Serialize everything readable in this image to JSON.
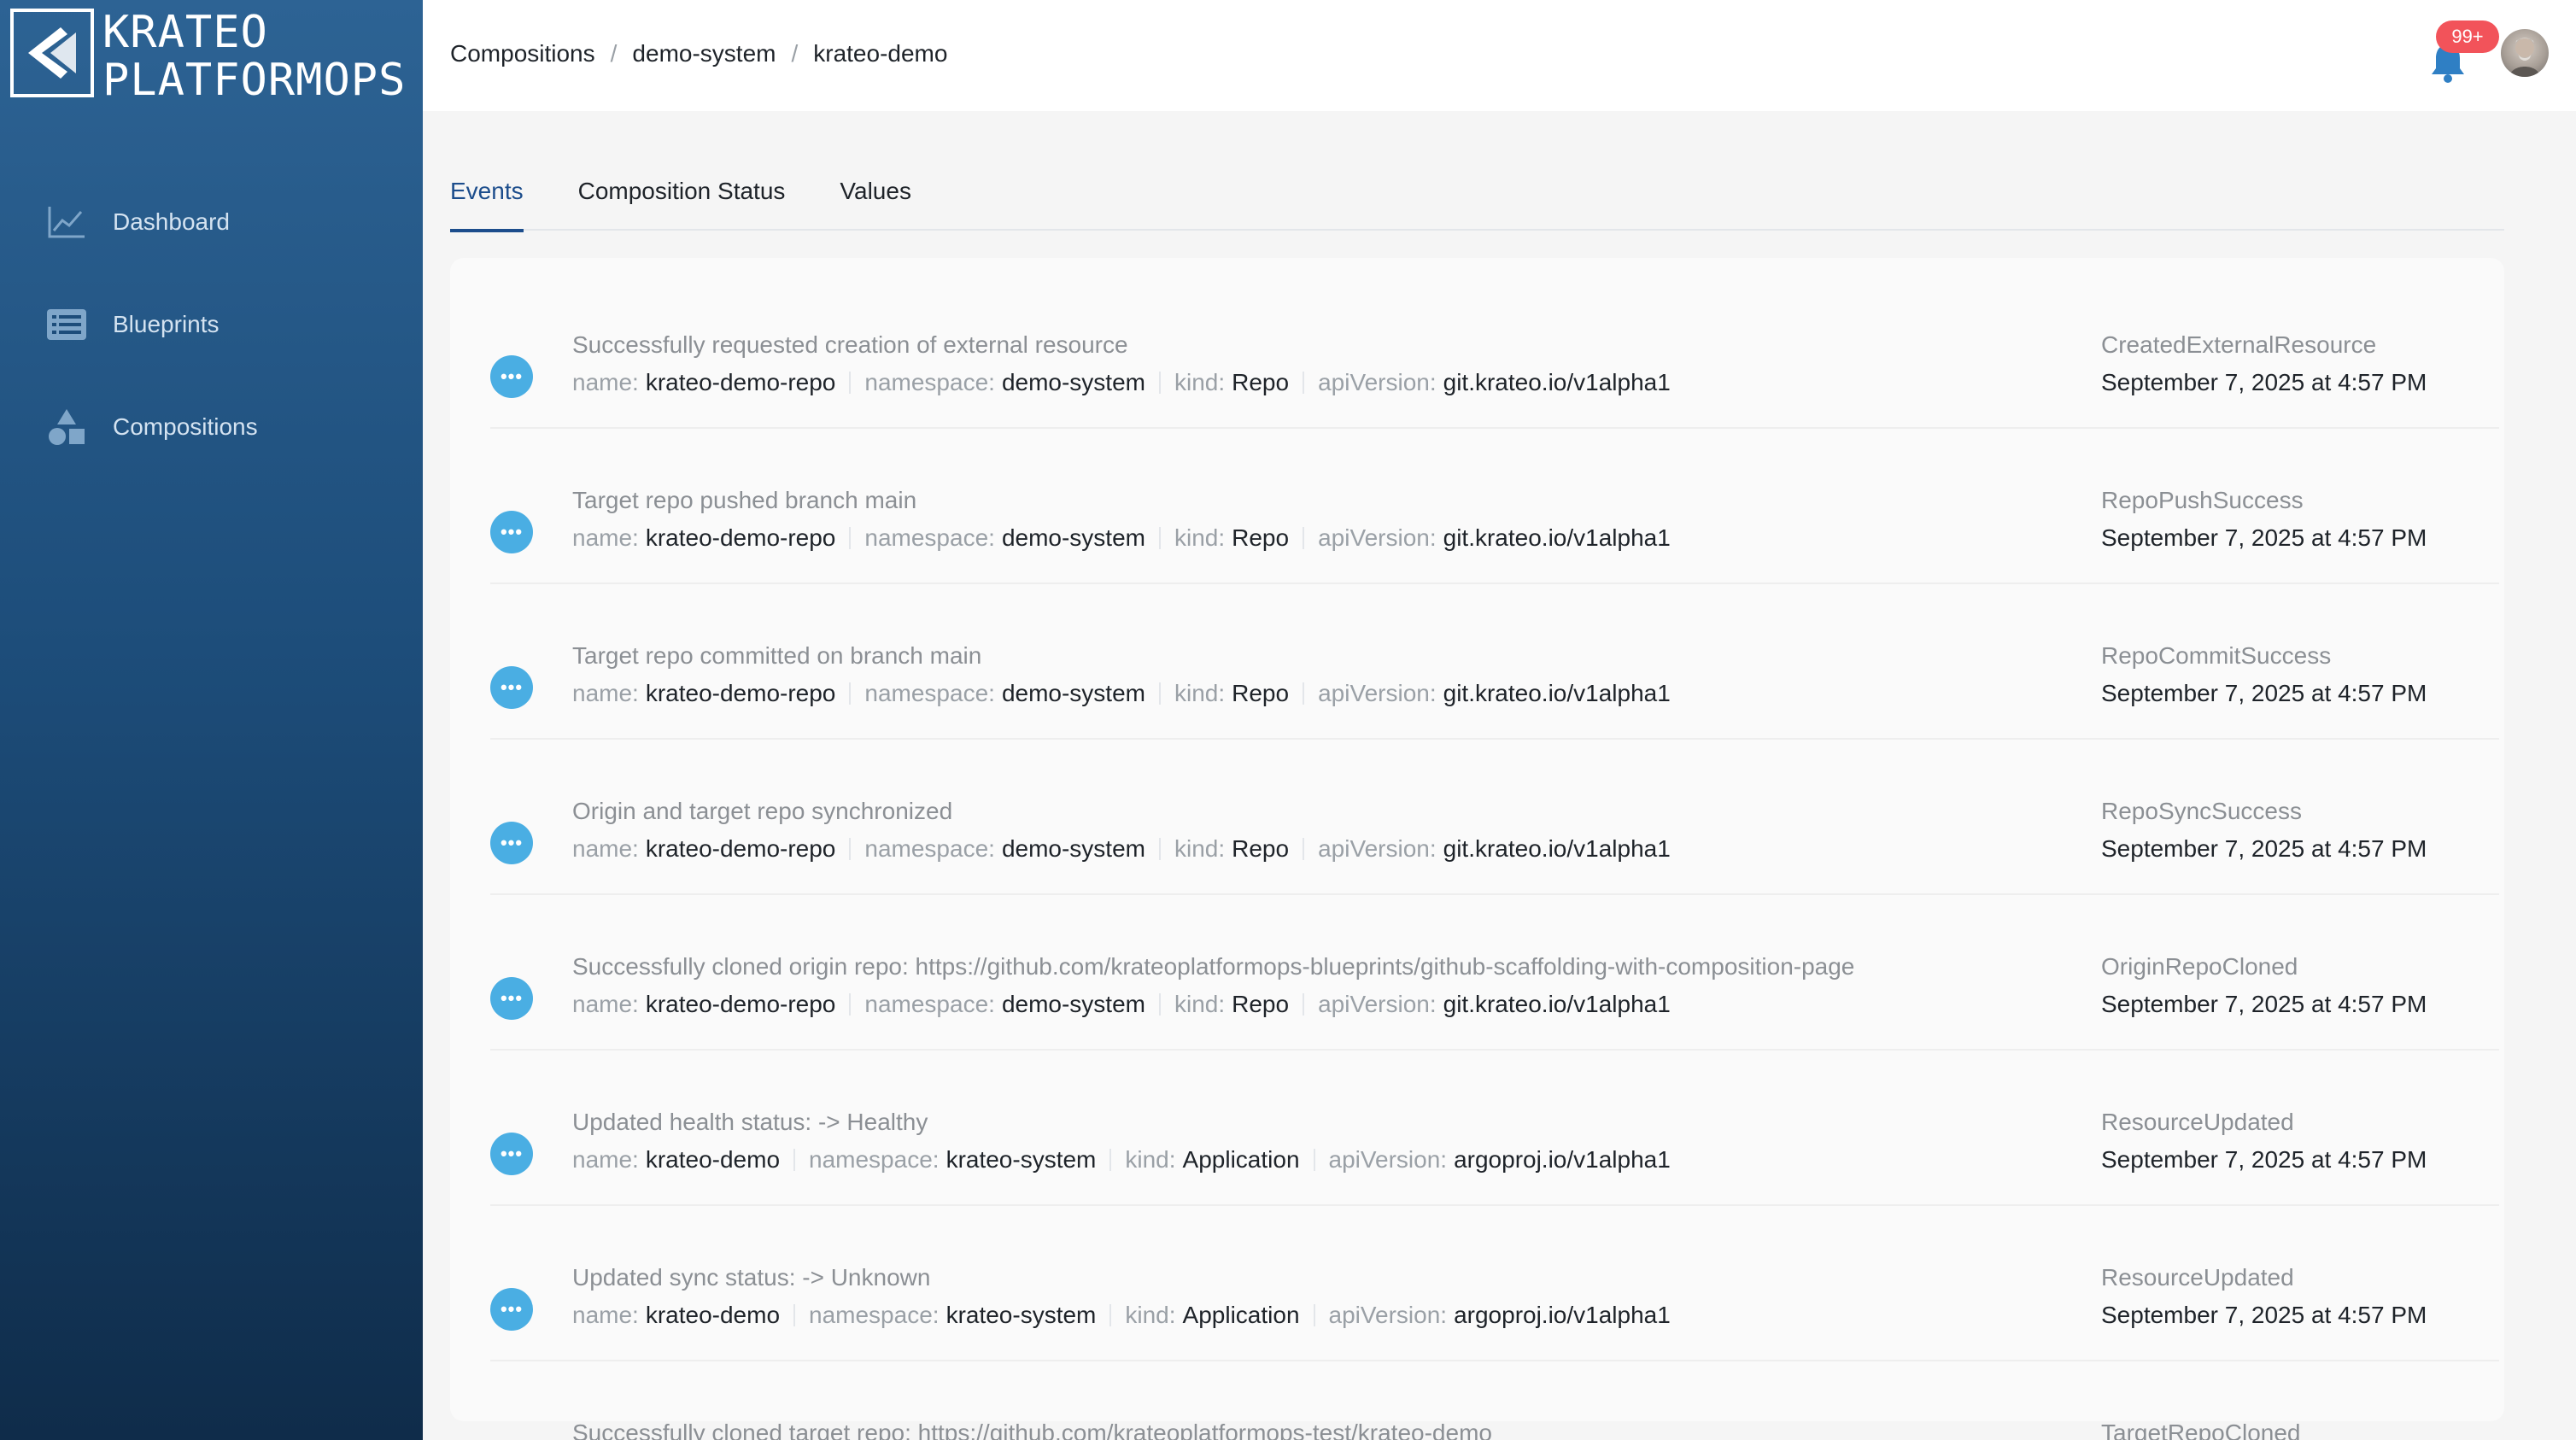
{
  "brand": {
    "line1": "KRATEO",
    "line2": "PLATFORMOPS"
  },
  "sidebar": {
    "items": [
      {
        "label": "Dashboard",
        "icon": "chart-line-icon"
      },
      {
        "label": "Blueprints",
        "icon": "list-icon"
      },
      {
        "label": "Compositions",
        "icon": "shapes-icon"
      }
    ]
  },
  "header": {
    "breadcrumb": [
      "Compositions",
      "demo-system",
      "krateo-demo"
    ],
    "notifications_badge": "99+"
  },
  "tabs": [
    "Events",
    "Composition Status",
    "Values"
  ],
  "active_tab": "Events",
  "colors": {
    "accent": "#1c4d8c",
    "event_dot": "#4aaee3",
    "badge": "#f2535a"
  },
  "meta_labels": {
    "name": "name:",
    "namespace": "namespace:",
    "kind": "kind:",
    "apiVersion": "apiVersion:"
  },
  "dot_glyph": "•••",
  "events": [
    {
      "message": "Successfully requested creation of external resource",
      "name": "krateo-demo-repo",
      "namespace": "demo-system",
      "kind": "Repo",
      "apiVersion": "git.krateo.io/v1alpha1",
      "reason": "CreatedExternalResource",
      "time": "September 7, 2025 at 4:57 PM"
    },
    {
      "message": "Target repo pushed branch main",
      "name": "krateo-demo-repo",
      "namespace": "demo-system",
      "kind": "Repo",
      "apiVersion": "git.krateo.io/v1alpha1",
      "reason": "RepoPushSuccess",
      "time": "September 7, 2025 at 4:57 PM"
    },
    {
      "message": "Target repo committed on branch main",
      "name": "krateo-demo-repo",
      "namespace": "demo-system",
      "kind": "Repo",
      "apiVersion": "git.krateo.io/v1alpha1",
      "reason": "RepoCommitSuccess",
      "time": "September 7, 2025 at 4:57 PM"
    },
    {
      "message": "Origin and target repo synchronized",
      "name": "krateo-demo-repo",
      "namespace": "demo-system",
      "kind": "Repo",
      "apiVersion": "git.krateo.io/v1alpha1",
      "reason": "RepoSyncSuccess",
      "time": "September 7, 2025 at 4:57 PM"
    },
    {
      "message": "Successfully cloned origin repo: https://github.com/krateoplatformops-blueprints/github-scaffolding-with-composition-page",
      "name": "krateo-demo-repo",
      "namespace": "demo-system",
      "kind": "Repo",
      "apiVersion": "git.krateo.io/v1alpha1",
      "reason": "OriginRepoCloned",
      "time": "September 7, 2025 at 4:57 PM"
    },
    {
      "message": "Updated health status: -> Healthy",
      "name": "krateo-demo",
      "namespace": "krateo-system",
      "kind": "Application",
      "apiVersion": "argoproj.io/v1alpha1",
      "reason": "ResourceUpdated",
      "time": "September 7, 2025 at 4:57 PM"
    },
    {
      "message": "Updated sync status: -> Unknown",
      "name": "krateo-demo",
      "namespace": "krateo-system",
      "kind": "Application",
      "apiVersion": "argoproj.io/v1alpha1",
      "reason": "ResourceUpdated",
      "time": "September 7, 2025 at 4:57 PM"
    },
    {
      "message": "Successfully cloned target repo: https://github.com/krateoplatformops-test/krateo-demo",
      "reason": "TargetRepoCloned"
    }
  ]
}
